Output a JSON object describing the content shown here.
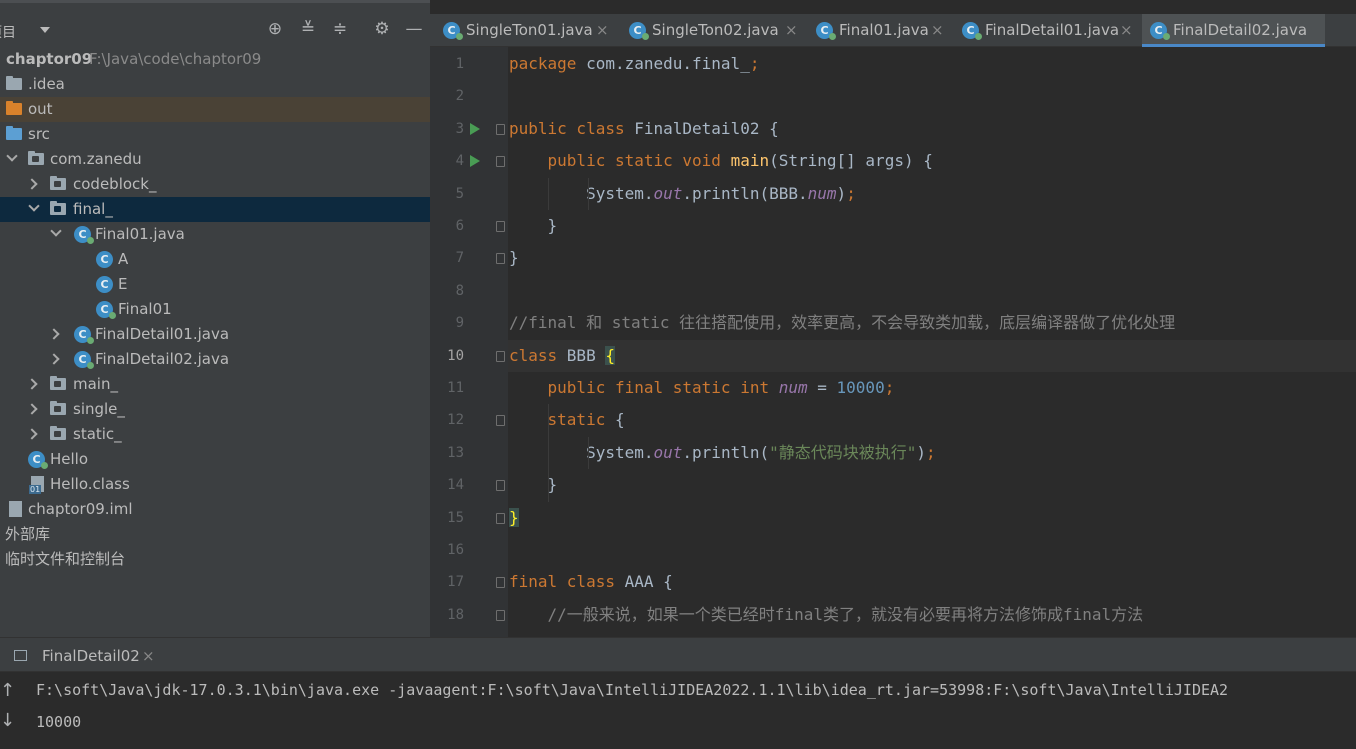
{
  "project_panel": {
    "title": "项目",
    "tree": [
      {
        "label": "chaptor09",
        "path": "F:\\Java\\code\\chaptor09"
      },
      {
        "label": ".idea"
      },
      {
        "label": "out"
      },
      {
        "label": "src"
      },
      {
        "label": "com.zanedu"
      },
      {
        "label": "codeblock_"
      },
      {
        "label": "final_"
      },
      {
        "label": "Final01.java"
      },
      {
        "label": "A"
      },
      {
        "label": "E"
      },
      {
        "label": "Final01"
      },
      {
        "label": "FinalDetail01.java"
      },
      {
        "label": "FinalDetail02.java"
      },
      {
        "label": "main_"
      },
      {
        "label": "single_"
      },
      {
        "label": "static_"
      },
      {
        "label": "Hello"
      },
      {
        "label": "Hello.class"
      },
      {
        "label": "chaptor09.iml"
      },
      {
        "label": "外部库"
      },
      {
        "label": "临时文件和控制台"
      }
    ]
  },
  "editor": {
    "tabs": [
      {
        "label": "SingleTon01.java",
        "active": false
      },
      {
        "label": "SingleTon02.java",
        "active": false
      },
      {
        "label": "Final01.java",
        "active": false
      },
      {
        "label": "FinalDetail01.java",
        "active": false
      },
      {
        "label": "FinalDetail02.java",
        "active": true
      }
    ],
    "current_line": 10,
    "line_numbers": [
      "1",
      "2",
      "3",
      "4",
      "5",
      "6",
      "7",
      "8",
      "9",
      "10",
      "11",
      "12",
      "13",
      "14",
      "15",
      "16",
      "17",
      "18"
    ],
    "code": [
      {
        "t": [
          [
            "package ",
            "kw"
          ],
          [
            "com.zanedu.final_",
            ""
          ],
          [
            ";",
            "kw"
          ]
        ]
      },
      {
        "t": []
      },
      {
        "t": [
          [
            "public class ",
            "kw"
          ],
          [
            "FinalDetail02 {",
            ""
          ]
        ]
      },
      {
        "t": [
          [
            "    public static void ",
            "kw"
          ],
          [
            "main",
            "fn"
          ],
          [
            "(String[] args) {",
            ""
          ]
        ]
      },
      {
        "t": [
          [
            "        System.",
            ""
          ],
          [
            "out",
            "st"
          ],
          [
            ".println(BBB.",
            ""
          ],
          [
            "num",
            "st"
          ],
          [
            ")",
            ""
          ],
          [
            ";",
            "kw"
          ]
        ]
      },
      {
        "t": [
          [
            "    }",
            ""
          ]
        ]
      },
      {
        "t": [
          [
            "}",
            ""
          ]
        ]
      },
      {
        "t": []
      },
      {
        "t": [
          [
            "//final 和 static 往往搭配使用，效率更高，不会导致类加载，底层编译器做了优化处理",
            "cm"
          ]
        ]
      },
      {
        "t": [
          [
            "class ",
            "kw"
          ],
          [
            "BBB ",
            ""
          ],
          [
            "{",
            "hl-brace"
          ]
        ]
      },
      {
        "t": [
          [
            "    public final static int ",
            "kw"
          ],
          [
            "num",
            "st"
          ],
          [
            " = ",
            ""
          ],
          [
            "10000",
            "num"
          ],
          [
            ";",
            "kw"
          ]
        ]
      },
      {
        "t": [
          [
            "    static ",
            "kw"
          ],
          [
            "{",
            ""
          ]
        ]
      },
      {
        "t": [
          [
            "        System.",
            ""
          ],
          [
            "out",
            "st"
          ],
          [
            ".println(",
            ""
          ],
          [
            "\"静态代码块被执行\"",
            "str"
          ],
          [
            ")",
            ""
          ],
          [
            ";",
            "kw"
          ]
        ]
      },
      {
        "t": [
          [
            "    }",
            ""
          ]
        ]
      },
      {
        "t": [
          [
            "}",
            "hl-brace"
          ]
        ]
      },
      {
        "t": []
      },
      {
        "t": [
          [
            "final class ",
            "kw"
          ],
          [
            "AAA {",
            ""
          ]
        ]
      },
      {
        "t": [
          [
            "    //一般来说，如果一个类已经时final类了，就没有必要再将方法修饰成final方法",
            "cm"
          ]
        ]
      }
    ]
  },
  "run_panel": {
    "tab_label": "FinalDetail02",
    "close_glyph": "×",
    "console": [
      "F:\\soft\\Java\\jdk-17.0.3.1\\bin\\java.exe -javaagent:F:\\soft\\Java\\IntelliJIDEA2022.1.1\\lib\\idea_rt.jar=53998:F:\\soft\\Java\\IntelliJIDEA2",
      "10000"
    ]
  },
  "icons": {
    "target": "⊕",
    "expand_all": "≚",
    "collapse_all": "≑",
    "settings": "⚙",
    "minimize": "—",
    "up": "↑",
    "down": "↓",
    "close": "×"
  },
  "colors": {
    "keyword": "#cc7832",
    "method": "#ffc66d",
    "comment": "#808080",
    "static_field": "#9876aa",
    "number": "#6897bb",
    "string": "#6a8759",
    "tab_accent": "#4a88c7"
  }
}
